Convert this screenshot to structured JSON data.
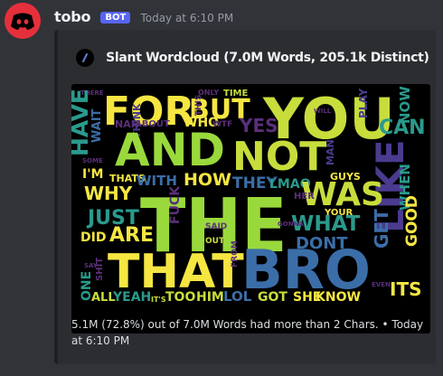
{
  "message": {
    "username": "tobo",
    "bot_tag": "BOT",
    "timestamp": "Today at 6:10 PM"
  },
  "embed": {
    "title": "Slant Wordcloud (7.0M Words, 205.1k Distinct)",
    "footer": "5.1M (72.8%) out of 7.0M Words had more than 2 Chars. • Today at 6:10 PM",
    "wordcloud": {
      "words": [
        "THERE",
        "FOR",
        "BUT",
        "ONLY",
        "TIME",
        "YOU",
        "WILL",
        "PLAY",
        "CAN",
        "NOW",
        "HAVE",
        "WAIT",
        "NAH",
        "THINK",
        "ABOUT",
        "WHO",
        "WTF",
        "THIS",
        "YES",
        "AND",
        "NOT",
        "MAN",
        "SOME",
        "I'M",
        "THATS",
        "WITH",
        "HOW",
        "THEY",
        "LMAO",
        "GUYS",
        "LIKE",
        "WHEN",
        "WHY",
        "WAS",
        "HER",
        "YOUR",
        "JUST",
        "THE",
        "WHAT",
        "GET",
        "GOOD",
        "DID",
        "ARE",
        "FUCK",
        "SAID",
        "OUT",
        "GONNA",
        "DONT",
        "SAY",
        "SHIT",
        "THAT",
        "FROM",
        "BRO",
        "ONE",
        "EVEN",
        "ALL",
        "YEAH",
        "IT'S",
        "TOO",
        "HIM",
        "LOL",
        "GOT",
        "SHE",
        "KNOW",
        "ITS"
      ],
      "palette": [
        "#f5e642",
        "#9ad93c",
        "#3fbb6f",
        "#2a9a8c",
        "#3b6ea8",
        "#4a3b8f",
        "#5a2f7a",
        "#c8dd3c",
        "#63c858"
      ]
    }
  }
}
